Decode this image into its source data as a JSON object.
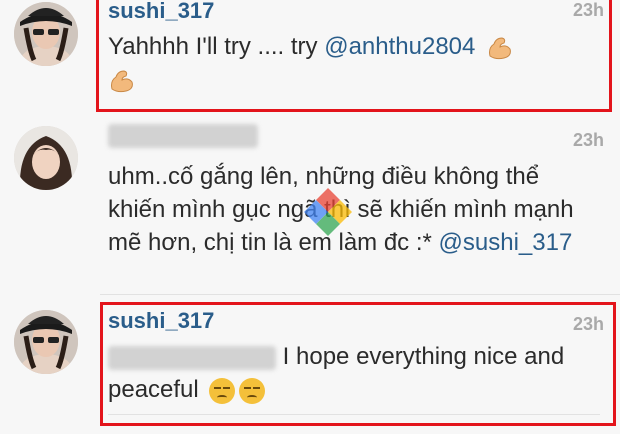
{
  "comments": [
    {
      "username": "sushi_317",
      "time": "23h",
      "text_before": "Yahhhh I'll try .... try ",
      "mention": "@anhthu2804",
      "emoji": [
        "flexed-biceps",
        "flexed-biceps"
      ]
    },
    {
      "username": "",
      "time": "23h",
      "text": "uhm..cố gắng lên, những điều không thể khiến mình gục ngã thì sẽ khiến mình mạnh mẽ hơn, chị tin là em làm đc :* ",
      "mention": "@sushi_317"
    },
    {
      "username": "sushi_317",
      "time": "23h",
      "text": "I hope everything nice and peaceful",
      "emoji": [
        "unamused-face",
        "unamused-face"
      ]
    }
  ],
  "colors": {
    "username": "#2a5d8a",
    "highlight": "#e3141b",
    "time": "#a9a9a9",
    "background": "#f7f7f7"
  }
}
